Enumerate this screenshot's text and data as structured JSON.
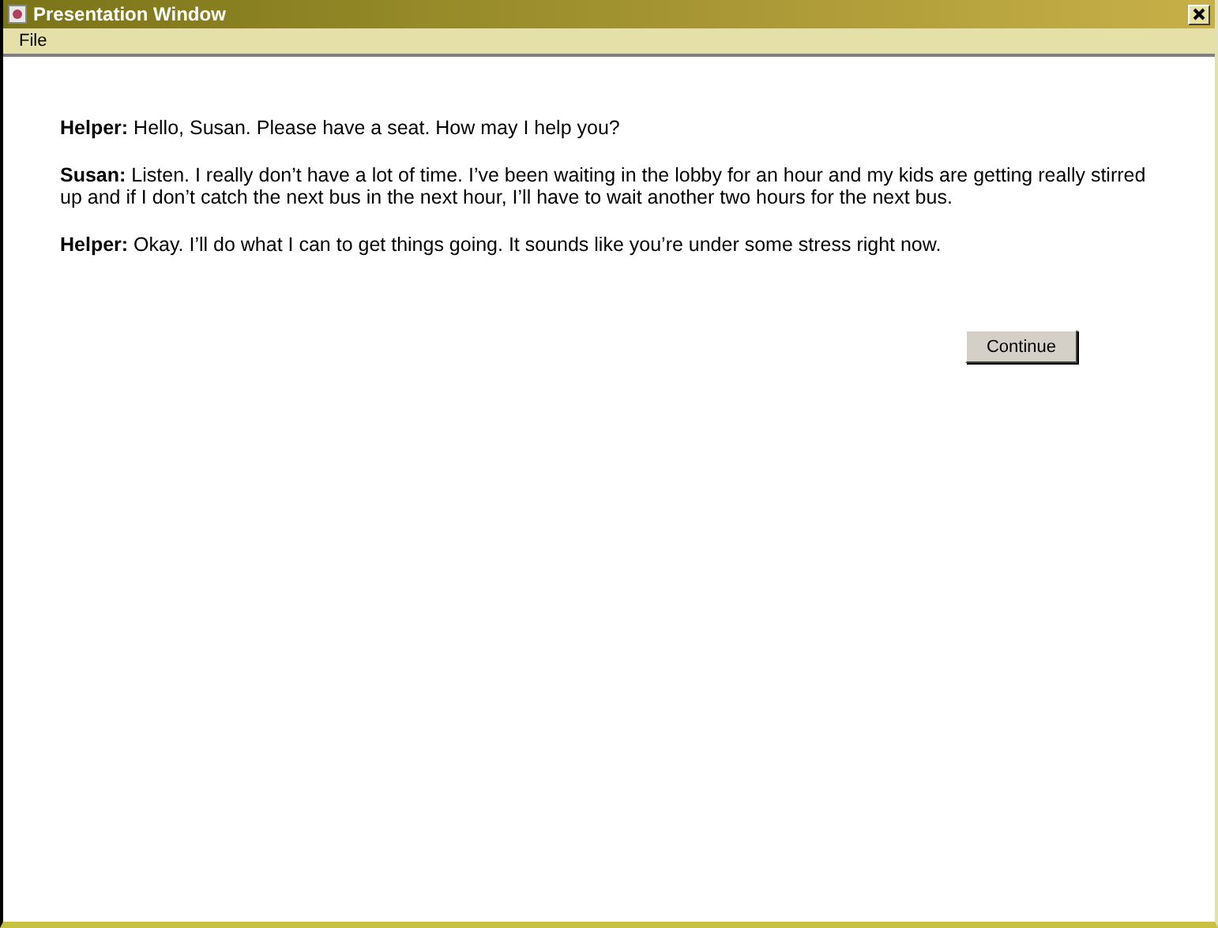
{
  "window": {
    "title": "Presentation Window"
  },
  "menu": [
    "File"
  ],
  "dialogue": [
    {
      "speaker": "Helper:",
      "text": "Hello, Susan. Please have a seat. How may I help you?"
    },
    {
      "speaker": "Susan:",
      "text": " Listen. I really don’t have a lot of time. I’ve been waiting in the lobby for an hour and my kids are getting really stirred up and if I don’t catch the next bus in the next hour, I’ll have to wait another two hours for the next bus."
    },
    {
      "speaker": "Helper:",
      "text": "Okay. I’ll do what I can to get things going. It sounds like you’re under some stress right now."
    }
  ],
  "button": "Continue"
}
